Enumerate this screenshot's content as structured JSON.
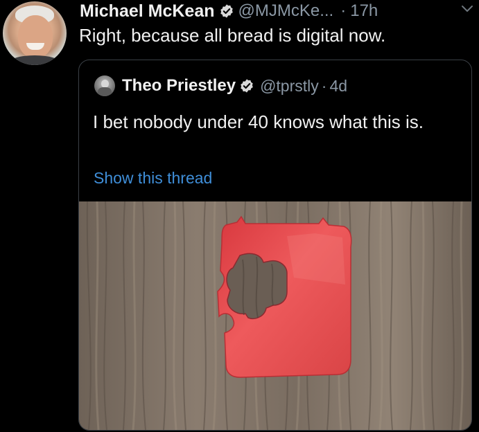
{
  "tweet": {
    "author_name": "Michael McKean",
    "author_handle": "@MJMcKe...",
    "separator": "·",
    "time": "17h",
    "text": "Right, because all bread is digital now.",
    "avatar_icon": "person-avatar",
    "verified_icon": "verified-badge-icon",
    "more_icon": "chevron-down-icon"
  },
  "quoted": {
    "author_name": "Theo Priestley",
    "author_handle": "@tprstly",
    "separator": "·",
    "time": "4d",
    "text": "I bet nobody under 40 knows what this is.",
    "show_thread_label": "Show this thread",
    "media_description_icon": "bread-clip-photo"
  },
  "colors": {
    "background": "#000000",
    "primary_text": "#f1f1f1",
    "secondary_text": "#8b98a5",
    "link": "#3f8ed8",
    "card_border": "#3b4046",
    "clip_red": "#e0454a"
  }
}
